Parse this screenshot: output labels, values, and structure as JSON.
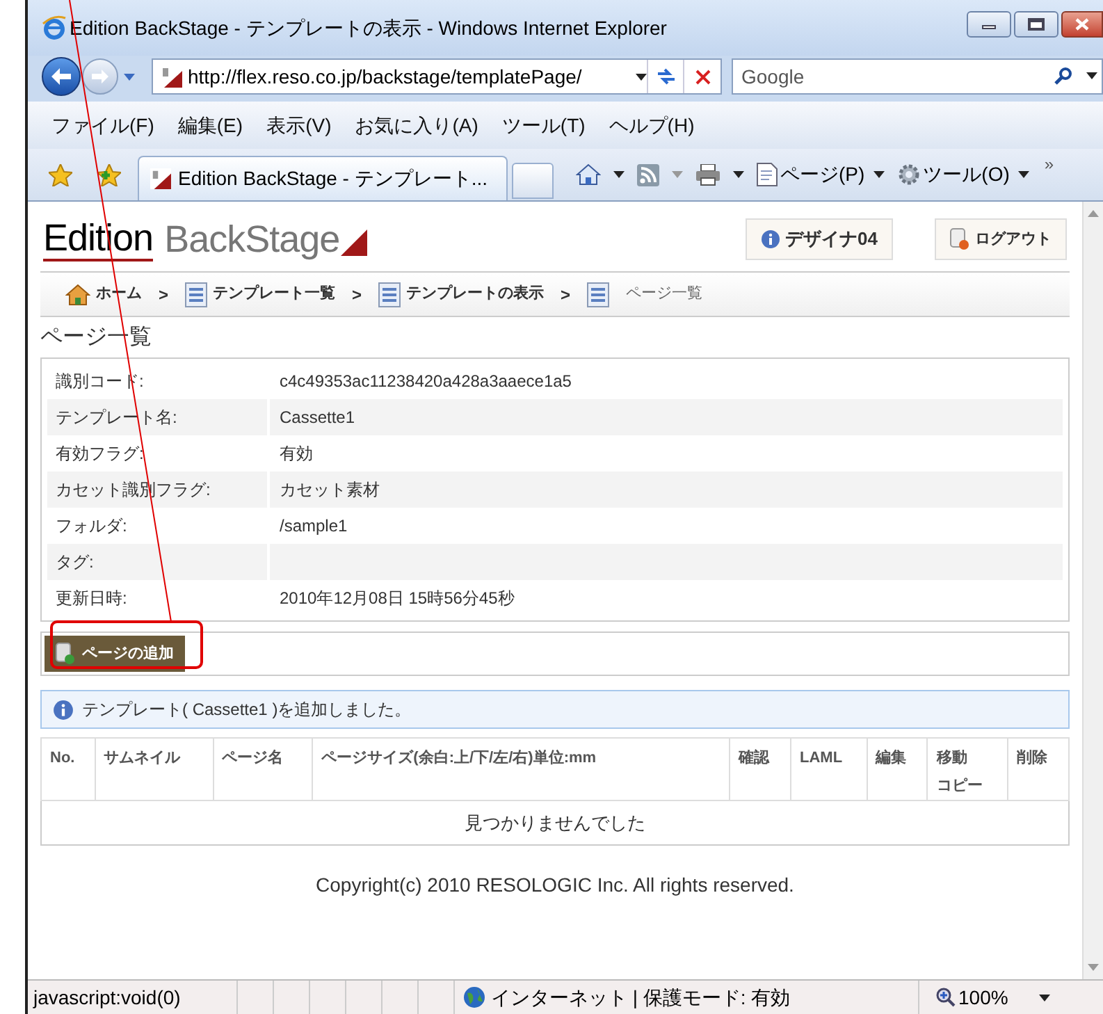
{
  "window": {
    "title": "Edition BackStage - テンプレートの表示 - Windows Internet Explorer"
  },
  "address_bar": {
    "url": "http://flex.reso.co.jp/backstage/templatePage/"
  },
  "search": {
    "placeholder": "Google"
  },
  "menu": [
    "ファイル(F)",
    "編集(E)",
    "表示(V)",
    "お気に入り(A)",
    "ツール(T)",
    "ヘルプ(H)"
  ],
  "tab": {
    "title": "Edition BackStage - テンプレート..."
  },
  "toolbar": {
    "page_menu": "ページ(P)",
    "tools_menu": "ツール(O)",
    "overflow": "»"
  },
  "header": {
    "logo_main": "Edition",
    "logo_sub": "BackStage",
    "user_button": "デザイナ04",
    "logout_button": "ログアウト"
  },
  "breadcrumb": {
    "separator": ">",
    "items": [
      {
        "label": "ホーム",
        "kind": "home",
        "current": false
      },
      {
        "label": "テンプレート一覧",
        "kind": "sheet",
        "current": false
      },
      {
        "label": "テンプレートの表示",
        "kind": "sheet",
        "current": false
      },
      {
        "label": "ページ一覧",
        "kind": "sheet",
        "current": true
      }
    ]
  },
  "page_title": "ページ一覧",
  "details": [
    {
      "label": "識別コード:",
      "value": "c4c49353ac11238420a428a3aaece1a5"
    },
    {
      "label": "テンプレート名:",
      "value": "Cassette1"
    },
    {
      "label": "有効フラグ:",
      "value": "有効"
    },
    {
      "label": "カセット識別フラグ:",
      "value": "カセット素材"
    },
    {
      "label": "フォルダ:",
      "value": "/sample1"
    },
    {
      "label": "タグ:"
    },
    {
      "label": "更新日時:",
      "value": "2010年12月08日 15時56分45秒"
    }
  ],
  "add_page_button": "ページの追加",
  "message": "テンプレート( Cassette1 )を追加しました。",
  "table": {
    "columns": [
      {
        "lines": [
          "No."
        ]
      },
      {
        "lines": [
          "サムネイル"
        ]
      },
      {
        "lines": [
          "ページ名"
        ]
      },
      {
        "lines": [
          "ページサイズ(余白:上/下/左/右)単位:mm"
        ]
      },
      {
        "lines": [
          "確認"
        ]
      },
      {
        "lines": [
          "LAML"
        ]
      },
      {
        "lines": [
          "編集"
        ]
      },
      {
        "lines": [
          "移動",
          "コピー"
        ]
      },
      {
        "lines": [
          "削除"
        ]
      }
    ],
    "empty_text": "見つかりませんでした"
  },
  "footer": "Copyright(c) 2010 RESOLOGIC Inc. All rights reserved.",
  "status_bar": {
    "text": "javascript:void(0)",
    "zone": "インターネット | 保護モード: 有効",
    "zoom": "100%"
  }
}
